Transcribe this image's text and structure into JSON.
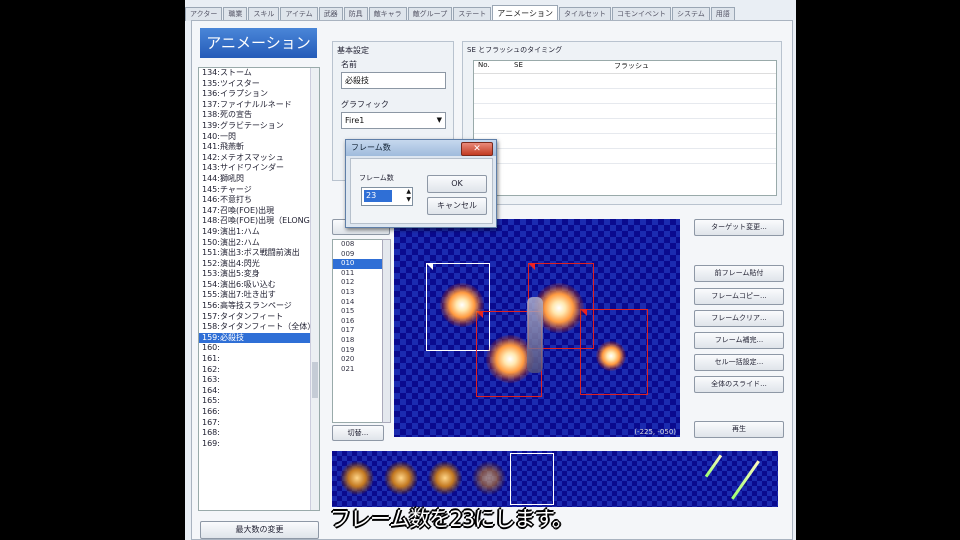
{
  "tabs": [
    "アクター",
    "職業",
    "スキル",
    "アイテム",
    "武器",
    "防具",
    "敵キャラ",
    "敵グループ",
    "ステート",
    "アニメーション",
    "タイルセット",
    "コモンイベント",
    "システム",
    "用語"
  ],
  "active_tab": 9,
  "list_title": "アニメーション",
  "animation_list": [
    {
      "label": "134:ストーム",
      "sel": false
    },
    {
      "label": "135:ツイスター",
      "sel": false
    },
    {
      "label": "136:イラプション",
      "sel": false
    },
    {
      "label": "137:ファイナルルネード",
      "sel": false
    },
    {
      "label": "138:死の宣告",
      "sel": false
    },
    {
      "label": "139:グラビテーション",
      "sel": false
    },
    {
      "label": "140:一閃",
      "sel": false
    },
    {
      "label": "141:飛燕斬",
      "sel": false
    },
    {
      "label": "142:メテオスマッシュ",
      "sel": false
    },
    {
      "label": "143:サイドワインダー",
      "sel": false
    },
    {
      "label": "144:獅吼閃",
      "sel": false
    },
    {
      "label": "145:チャージ",
      "sel": false
    },
    {
      "label": "146:不意打ち",
      "sel": false
    },
    {
      "label": "147:召喚(FOE)出現",
      "sel": false
    },
    {
      "label": "148:召喚(FOE)出現（ELONG）",
      "sel": false
    },
    {
      "label": "149:演出1:ハム",
      "sel": false
    },
    {
      "label": "150:演出2:ハム",
      "sel": false
    },
    {
      "label": "151:演出3:ボス戦闘前演出",
      "sel": false
    },
    {
      "label": "152:演出4:閃光",
      "sel": false
    },
    {
      "label": "153:演出5:変身",
      "sel": false
    },
    {
      "label": "154:演出6:吸い込む",
      "sel": false
    },
    {
      "label": "155:演出7:吐き出す",
      "sel": false
    },
    {
      "label": "156:高等技スランページ",
      "sel": false
    },
    {
      "label": "157:タイタンフィート",
      "sel": false
    },
    {
      "label": "158:タイタンフィート（全体）",
      "sel": false
    },
    {
      "label": "159:必殺技",
      "sel": true
    },
    {
      "label": "160:",
      "sel": false
    },
    {
      "label": "161:",
      "sel": false
    },
    {
      "label": "162:",
      "sel": false
    },
    {
      "label": "163:",
      "sel": false
    },
    {
      "label": "164:",
      "sel": false
    },
    {
      "label": "165:",
      "sel": false
    },
    {
      "label": "166:",
      "sel": false
    },
    {
      "label": "167:",
      "sel": false
    },
    {
      "label": "168:",
      "sel": false
    },
    {
      "label": "169:",
      "sel": false
    }
  ],
  "max_button": "最大数の変更",
  "basic": {
    "header": "基本設定",
    "name_label": "名前",
    "name_value": "必殺技",
    "graphic_label": "グラフィック",
    "graphic_value": "Fire1"
  },
  "se": {
    "header": "SE とフラッシュのタイミング",
    "col_no": "No.",
    "col_se": "SE",
    "col_flash": "フラッシュ"
  },
  "frames": [
    "008",
    "009",
    "010",
    "011",
    "012",
    "013",
    "014",
    "015",
    "016",
    "017",
    "018",
    "019",
    "020",
    "021"
  ],
  "selected_frame": "010",
  "frame_change": "切替...",
  "coord": "(-225, -050)",
  "right_buttons": [
    "ターゲット変更...",
    "前フレーム貼付",
    "フレームコピー...",
    "フレームクリア...",
    "フレーム補完...",
    "セル一括設定...",
    "全体のスライド..."
  ],
  "play_button": "再生",
  "dialog": {
    "title": "フレーム数",
    "label": "フレーム数",
    "value": "23",
    "ok": "OK",
    "cancel": "キャンセル",
    "close": "✕"
  },
  "subtitle": "フレーム数を23にします。"
}
